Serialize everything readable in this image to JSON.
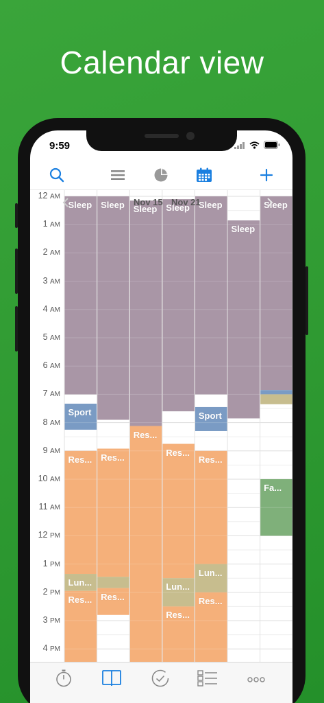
{
  "headline": "Calendar view",
  "status": {
    "time": "9:59"
  },
  "toolbar": {
    "items": [
      {
        "icon": "search-icon",
        "active": true
      },
      {
        "icon": "list-icon",
        "active": false
      },
      {
        "icon": "pie-chart-icon",
        "active": false
      },
      {
        "icon": "calendar-icon",
        "active": true
      },
      {
        "icon": "plus-icon",
        "active": true
      }
    ]
  },
  "calendar": {
    "range_start": "Nov 15",
    "range_end": "Nov 21",
    "hours": [
      {
        "num": "12",
        "ampm": "AM"
      },
      {
        "num": "1",
        "ampm": "AM"
      },
      {
        "num": "2",
        "ampm": "AM"
      },
      {
        "num": "3",
        "ampm": "AM"
      },
      {
        "num": "4",
        "ampm": "AM"
      },
      {
        "num": "5",
        "ampm": "AM"
      },
      {
        "num": "6",
        "ampm": "AM"
      },
      {
        "num": "7",
        "ampm": "AM"
      },
      {
        "num": "8",
        "ampm": "AM"
      },
      {
        "num": "9",
        "ampm": "AM"
      },
      {
        "num": "10",
        "ampm": "AM"
      },
      {
        "num": "11",
        "ampm": "AM"
      },
      {
        "num": "12",
        "ampm": "PM"
      },
      {
        "num": "1",
        "ampm": "PM"
      },
      {
        "num": "2",
        "ampm": "PM"
      },
      {
        "num": "3",
        "ampm": "PM"
      },
      {
        "num": "4",
        "ampm": "PM"
      }
    ],
    "days": 7,
    "events": [
      {
        "day": 0,
        "start": 0.0,
        "end": 7.0,
        "label": "Sleep",
        "color": "#a996a6"
      },
      {
        "day": 0,
        "start": 7.33,
        "end": 8.25,
        "label": "Sport",
        "color": "#7a9bc4"
      },
      {
        "day": 0,
        "start": 9.0,
        "end": 13.35,
        "label": "Res...",
        "color": "#f5b07a"
      },
      {
        "day": 0,
        "start": 13.35,
        "end": 13.95,
        "label": "Lun...",
        "color": "#c7bd8e"
      },
      {
        "day": 0,
        "start": 13.95,
        "end": 16.6,
        "label": "Res...",
        "color": "#f5b07a"
      },
      {
        "day": 1,
        "start": 0.0,
        "end": 7.9,
        "label": "Sleep",
        "color": "#a996a6"
      },
      {
        "day": 1,
        "start": 8.92,
        "end": 13.45,
        "label": "Res...",
        "color": "#f5b07a"
      },
      {
        "day": 1,
        "start": 13.45,
        "end": 13.85,
        "label": "",
        "color": "#c7bd8e"
      },
      {
        "day": 1,
        "start": 13.85,
        "end": 14.8,
        "label": "Res...",
        "color": "#f5b07a"
      },
      {
        "day": 2,
        "start": 0.15,
        "end": 8.12,
        "label": "Sleep",
        "color": "#a996a6"
      },
      {
        "day": 2,
        "start": 8.12,
        "end": 16.6,
        "label": "Res...",
        "color": "#f5b07a"
      },
      {
        "day": 3,
        "start": 0.1,
        "end": 7.6,
        "label": "Sleep",
        "color": "#a996a6"
      },
      {
        "day": 3,
        "start": 8.75,
        "end": 13.5,
        "label": "Res...",
        "color": "#f5b07a"
      },
      {
        "day": 3,
        "start": 13.5,
        "end": 14.5,
        "label": "Lun...",
        "color": "#c7bd8e"
      },
      {
        "day": 3,
        "start": 14.5,
        "end": 16.6,
        "label": "Res...",
        "color": "#f5b07a"
      },
      {
        "day": 4,
        "start": 0.0,
        "end": 7.0,
        "label": "Sleep",
        "color": "#a996a6"
      },
      {
        "day": 4,
        "start": 7.45,
        "end": 8.3,
        "label": "Sport",
        "color": "#7a9bc4"
      },
      {
        "day": 4,
        "start": 9.0,
        "end": 13.0,
        "label": "Res...",
        "color": "#f5b07a"
      },
      {
        "day": 4,
        "start": 13.0,
        "end": 14.0,
        "label": "Lun...",
        "color": "#c7bd8e"
      },
      {
        "day": 4,
        "start": 14.0,
        "end": 16.6,
        "label": "Res...",
        "color": "#f5b07a"
      },
      {
        "day": 5,
        "start": 0.85,
        "end": 7.85,
        "label": "Sleep",
        "color": "#a996a6"
      },
      {
        "day": 6,
        "start": 0.0,
        "end": 6.85,
        "label": "Sleep",
        "color": "#a996a6"
      },
      {
        "day": 6,
        "start": 6.85,
        "end": 7.0,
        "label": "",
        "color": "#7a9bc4"
      },
      {
        "day": 6,
        "start": 7.0,
        "end": 7.35,
        "label": "",
        "color": "#c7bd8e"
      },
      {
        "day": 6,
        "start": 10.0,
        "end": 12.0,
        "label": "Fa...",
        "color": "#7fb07a"
      }
    ]
  },
  "tabbar": {
    "items": [
      {
        "icon": "timer-icon",
        "active": false
      },
      {
        "icon": "book-icon",
        "active": true
      },
      {
        "icon": "check-circle-icon",
        "active": false
      },
      {
        "icon": "list-check-icon",
        "active": false
      },
      {
        "icon": "more-icon",
        "active": false
      }
    ]
  }
}
